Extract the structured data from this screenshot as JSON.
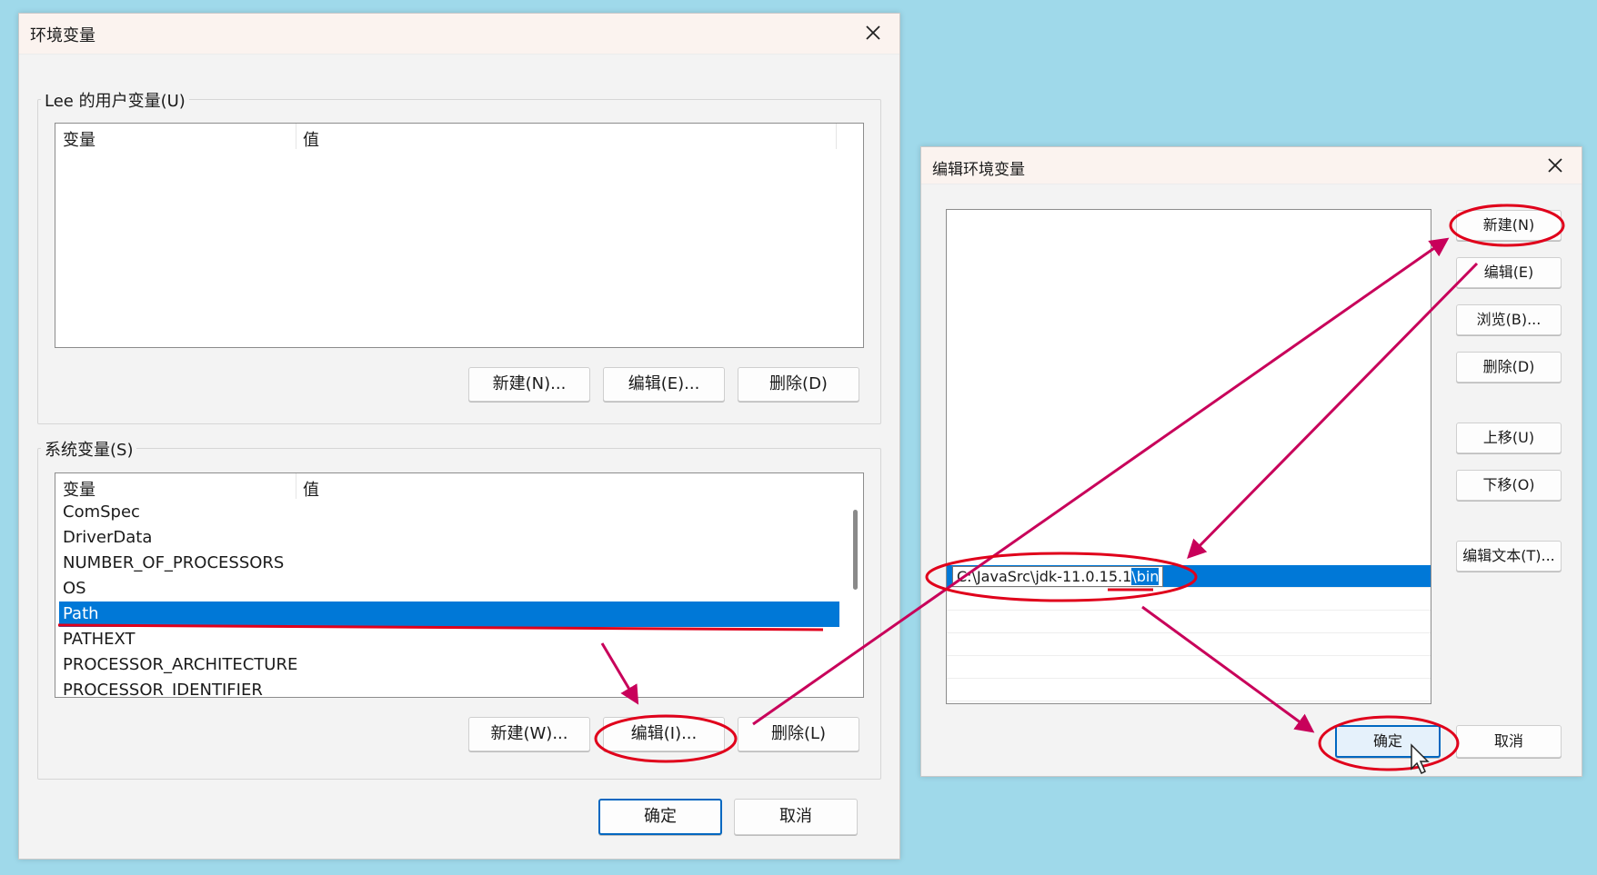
{
  "env_dialog": {
    "title": "环境变量",
    "user_group_label": "Lee 的用户变量(U)",
    "user_table": {
      "headers": [
        "变量",
        "值"
      ],
      "rows": []
    },
    "user_buttons": {
      "new": "新建(N)...",
      "edit": "编辑(E)...",
      "delete": "删除(D)"
    },
    "system_group_label": "系统变量(S)",
    "system_table": {
      "headers": [
        "变量",
        "值"
      ],
      "rows": [
        "ComSpec",
        "DriverData",
        "NUMBER_OF_PROCESSORS",
        "OS",
        "Path",
        "PATHEXT",
        "PROCESSOR_ARCHITECTURE",
        "PROCESSOR_IDENTIFIER"
      ],
      "selected": "Path"
    },
    "system_buttons": {
      "new": "新建(W)...",
      "edit": "编辑(I)...",
      "delete": "删除(L)"
    },
    "ok": "确定",
    "cancel": "取消"
  },
  "edit_dialog": {
    "title": "编辑环境变量",
    "entry_value_prefix": "C:\\JavaSrc\\jdk-11.0.15.1",
    "entry_value_selected": "\\bin",
    "buttons": {
      "new": "新建(N)",
      "edit": "编辑(E)",
      "browse": "浏览(B)...",
      "delete": "删除(D)",
      "move_up": "上移(U)",
      "move_down": "下移(O)",
      "edit_text": "编辑文本(T)..."
    },
    "ok": "确定",
    "cancel": "取消"
  },
  "colors": {
    "background": "#9fd9ea",
    "selection": "#0078d7",
    "annotation": "#c8005a",
    "ellipse": "#e0001b"
  }
}
